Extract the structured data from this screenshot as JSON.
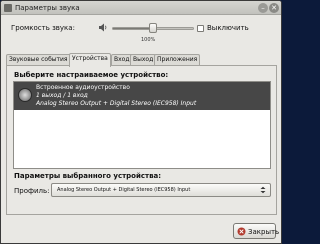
{
  "window": {
    "title": "Параметры звука",
    "minimize_symbol": "–",
    "close_symbol": "✕"
  },
  "volume": {
    "label": "Громкость звука:",
    "value_label": "100%",
    "level_percent": 100,
    "mute_label": "Выключить",
    "mute_checked": false,
    "icon": "speaker-icon"
  },
  "tabs": [
    {
      "label": "Звуковые события",
      "active": false
    },
    {
      "label": "Устройства",
      "active": true
    },
    {
      "label": "Вход",
      "active": false
    },
    {
      "label": "Выход",
      "active": false
    },
    {
      "label": "Приложения",
      "active": false
    }
  ],
  "devices": {
    "heading": "Выберите настраиваемое устройство:",
    "items": [
      {
        "name": "Встроенное аудиоустройство",
        "status": "1 выход / 1 вход",
        "ports": "Analog Stereo Output + Digital Stereo (IEC958) Input",
        "selected": true,
        "icon": "audio-card-icon"
      }
    ]
  },
  "settings": {
    "heading": "Параметры выбранного устройства:",
    "profile_label": "Профиль:",
    "profile_value": "Analog Stereo Output + Digital Stereo (IEC958) Input"
  },
  "footer": {
    "close_label": "Закрыть",
    "close_icon": "close-icon"
  },
  "colors": {
    "selection": "#474747",
    "window_bg": "#e9e8e4"
  }
}
